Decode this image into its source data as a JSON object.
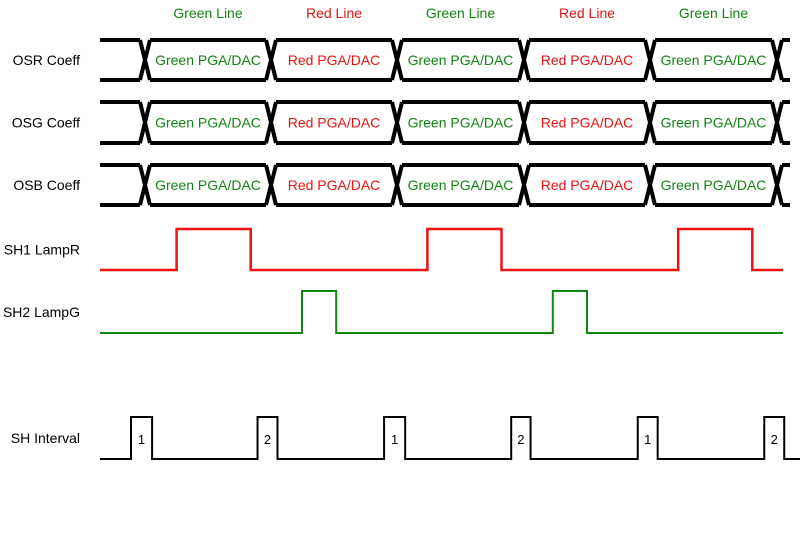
{
  "colors": {
    "green": "#128512",
    "red": "#ee1111",
    "black": "#000000"
  },
  "headers": [
    {
      "text": "Green Line",
      "color": "green"
    },
    {
      "text": "Red Line",
      "color": "red"
    },
    {
      "text": "Green Line",
      "color": "green"
    },
    {
      "text": "Red Line",
      "color": "red"
    },
    {
      "text": "Green Line",
      "color": "green"
    }
  ],
  "buses": [
    {
      "label": "OSR Coeff",
      "segments": [
        {
          "text": "Green PGA/DAC",
          "color": "green"
        },
        {
          "text": "Red PGA/DAC",
          "color": "red"
        },
        {
          "text": "Green PGA/DAC",
          "color": "green"
        },
        {
          "text": "Red PGA/DAC",
          "color": "red"
        },
        {
          "text": "Green PGA/DAC",
          "color": "green"
        }
      ]
    },
    {
      "label": "OSG Coeff",
      "segments": [
        {
          "text": "Green PGA/DAC",
          "color": "green"
        },
        {
          "text": "Red PGA/DAC",
          "color": "red"
        },
        {
          "text": "Green PGA/DAC",
          "color": "green"
        },
        {
          "text": "Red PGA/DAC",
          "color": "red"
        },
        {
          "text": "Green PGA/DAC",
          "color": "green"
        }
      ]
    },
    {
      "label": "OSB Coeff",
      "segments": [
        {
          "text": "Green PGA/DAC",
          "color": "green"
        },
        {
          "text": "Red PGA/DAC",
          "color": "red"
        },
        {
          "text": "Green PGA/DAC",
          "color": "green"
        },
        {
          "text": "Red PGA/DAC",
          "color": "red"
        },
        {
          "text": "Green PGA/DAC",
          "color": "green"
        }
      ]
    }
  ],
  "signals": [
    {
      "label": "SH1 LampR",
      "color": "red",
      "pulses": [
        [
          0.08,
          0.21
        ],
        [
          0.52,
          0.65
        ],
        [
          0.96,
          1.09
        ]
      ]
    },
    {
      "label": "SH2 LampG",
      "color": "green",
      "pulses": [
        [
          0.3,
          0.36
        ],
        [
          0.74,
          0.8
        ]
      ]
    },
    {
      "label": "SH Interval",
      "color": "black",
      "pulses": [
        [
          0.0,
          0.037
        ],
        [
          0.222,
          0.257
        ],
        [
          0.444,
          0.481
        ],
        [
          0.667,
          0.701
        ],
        [
          0.889,
          0.924
        ],
        [
          1.111,
          1.146
        ]
      ],
      "pulse_labels": [
        "1",
        "2",
        "1",
        "2",
        "1",
        "2"
      ]
    }
  ]
}
